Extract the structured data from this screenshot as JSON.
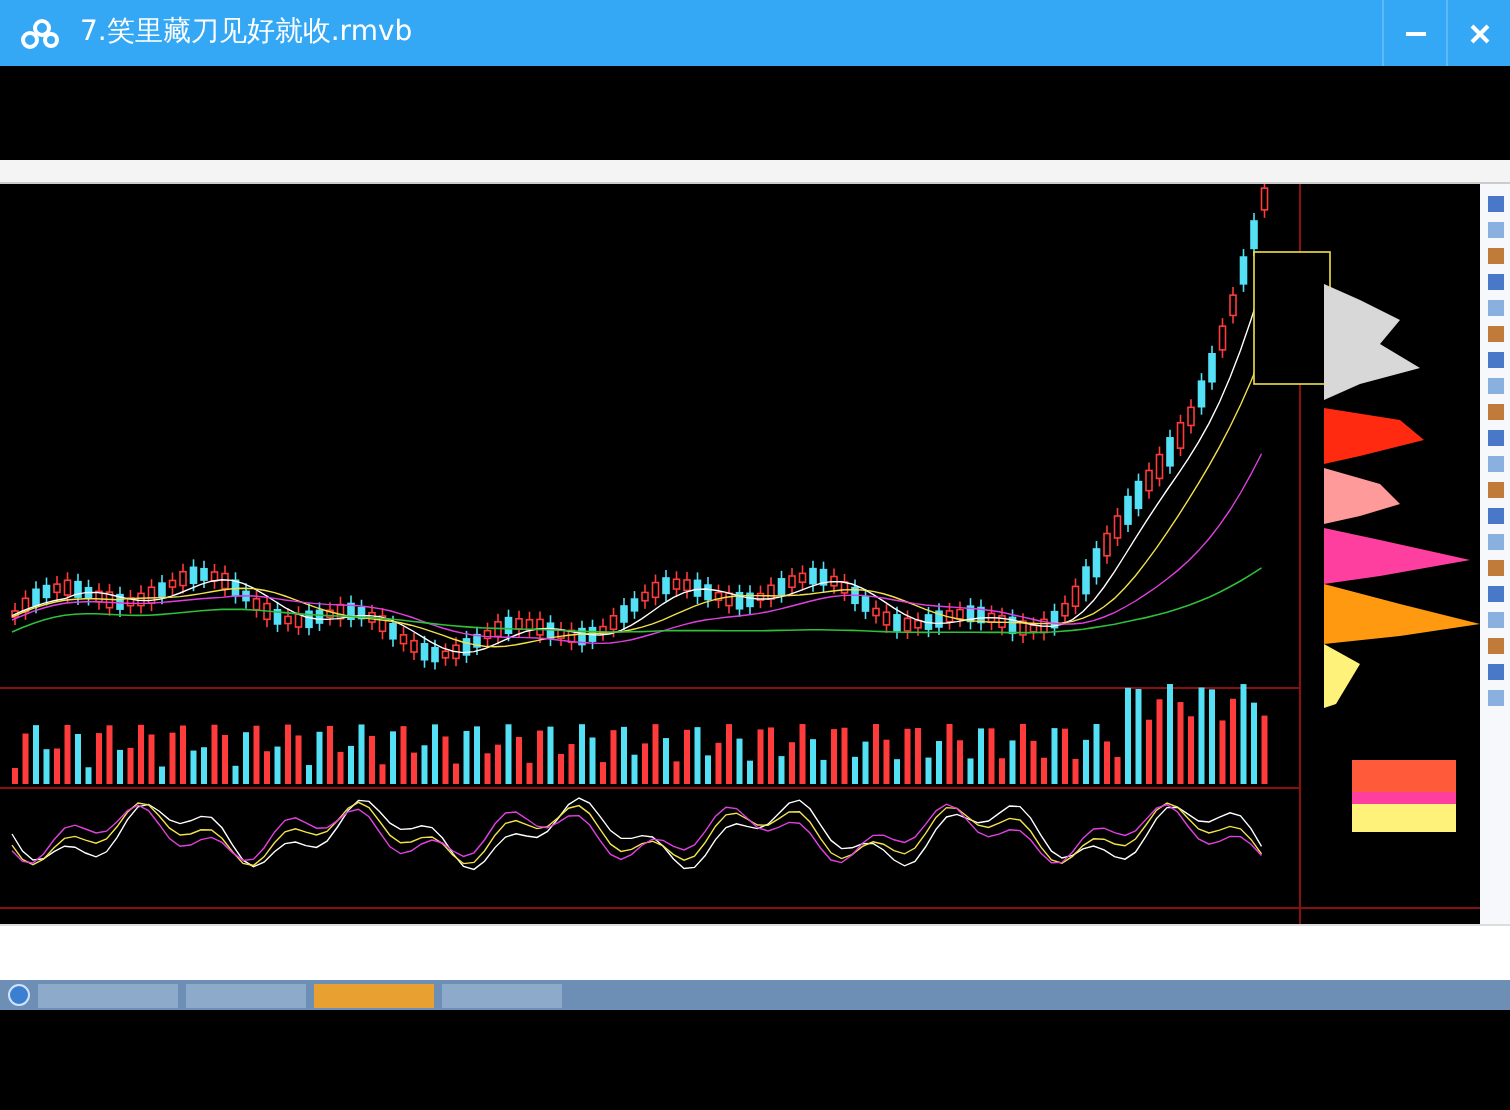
{
  "window": {
    "title": "7.笑里藏刀见好就收.rmvb"
  }
}
